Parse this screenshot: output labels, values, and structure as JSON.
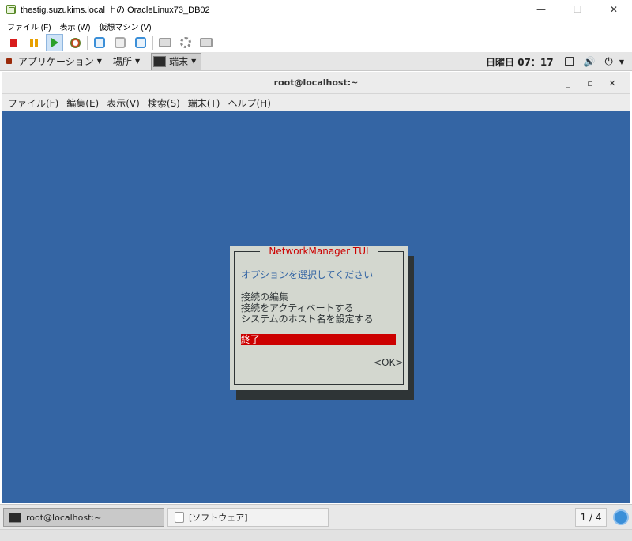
{
  "window": {
    "title": "thestig.suzukims.local 上の OracleLinux73_DB02",
    "minimize": "—",
    "maximize": "☐",
    "close": "✕"
  },
  "vm_menu": [
    "ファイル (F)",
    "表示 (W)",
    "仮想マシン (V)"
  ],
  "toolbar": {
    "icons": [
      "stop-icon",
      "pause-icon",
      "play-icon",
      "reset-icon",
      "snapshot-icon",
      "snapshot-manage-icon",
      "settings-icon",
      "network-icon",
      "console-icon",
      "share-icon"
    ]
  },
  "gnome_panel": {
    "applications": "アプリケーション",
    "places": "場所",
    "terminal": "端末",
    "caret": "▼",
    "clock": "日曜日 07：17",
    "sound_icon": "🔊",
    "power_icon": "⏻"
  },
  "terminal": {
    "title": "root@localhost:~",
    "min": "_",
    "max": "▫",
    "close": "✕",
    "menu": [
      "ファイル(F)",
      "編集(E)",
      "表示(V)",
      "検索(S)",
      "端末(T)",
      "ヘルプ(H)"
    ]
  },
  "tui": {
    "title": "NetworkManager TUI",
    "prompt": "オプションを選択してください",
    "items": [
      "接続の編集",
      "接続をアクティベートする",
      "システムのホスト名を設定する"
    ],
    "selected": "終了",
    "ok": "<OK>"
  },
  "taskbar": {
    "tasks": [
      "root@localhost:~",
      "[ソフトウェア]"
    ],
    "workspace": "1 / 4"
  },
  "colors": {
    "terminal_bg": "#3465a4",
    "dialog_bg": "#d3d7cf",
    "accent_red": "#cc0000"
  }
}
